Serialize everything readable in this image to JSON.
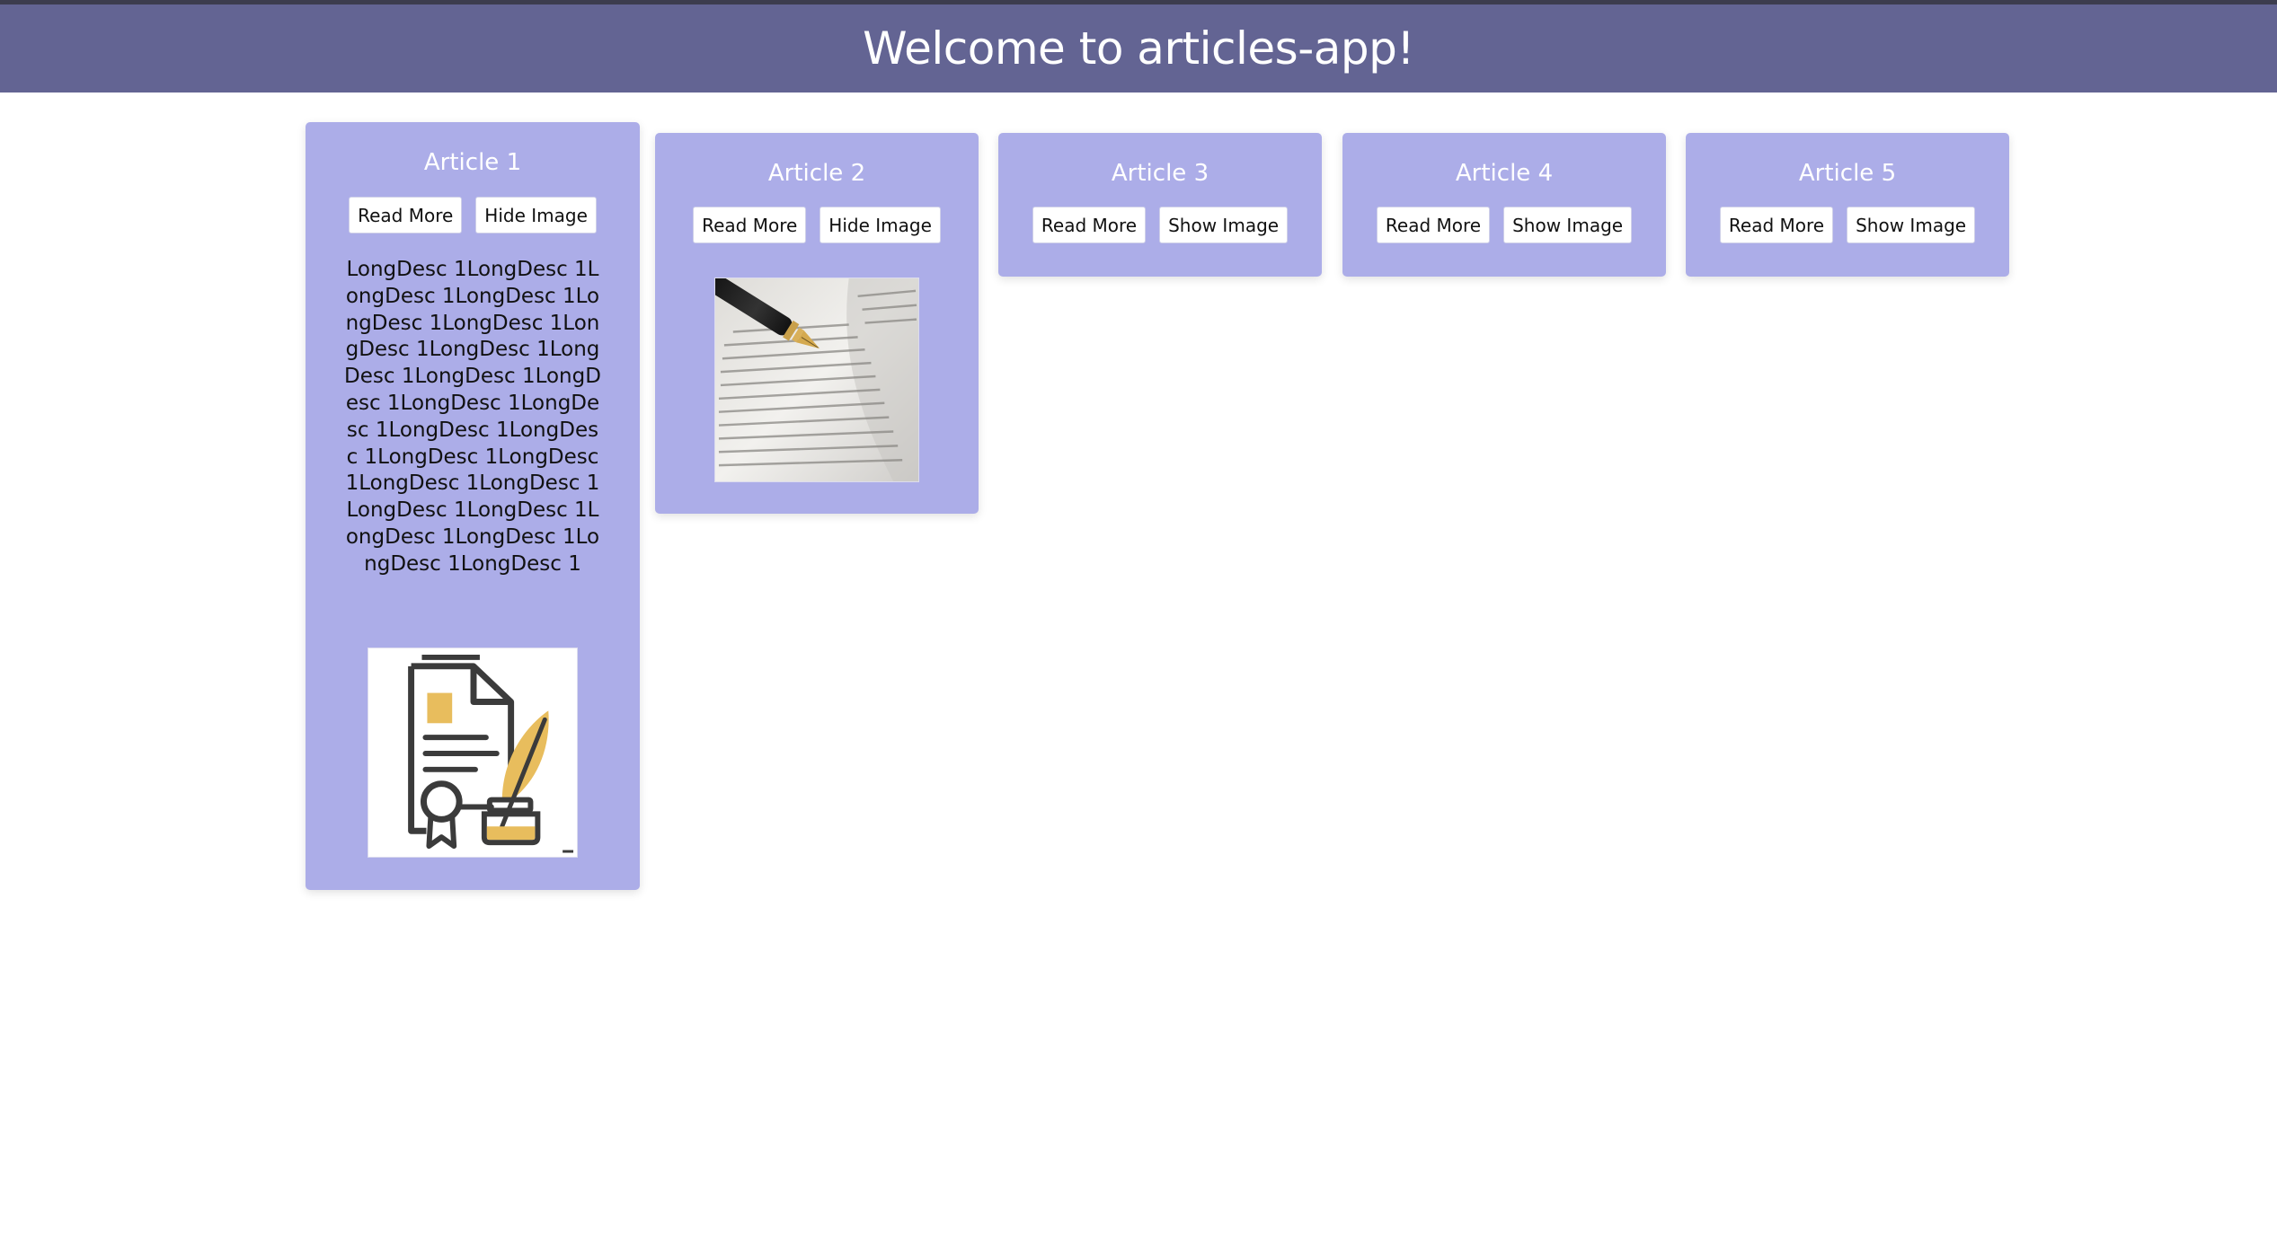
{
  "header": {
    "title": "Welcome to articles-app!"
  },
  "articles": [
    {
      "title": "Article 1",
      "read_more_label": "Read More",
      "image_toggle_label": "Hide Image",
      "description": "LongDesc 1LongDesc 1LongDesc 1LongDesc 1LongDesc 1LongDesc 1LongDesc 1LongDesc 1LongDesc 1LongDesc 1LongDesc 1LongDesc 1LongDesc 1LongDesc 1LongDesc 1LongDesc 1LongDesc 1LongDesc 1LongDesc 1LongDesc 1LongDesc 1LongDesc 1LongDesc 1LongDesc 1LongDesc 1",
      "image": "certificate-quill-icon"
    },
    {
      "title": "Article 2",
      "read_more_label": "Read More",
      "image_toggle_label": "Hide Image",
      "image": "fountain-pen-on-book-photo"
    },
    {
      "title": "Article 3",
      "read_more_label": "Read More",
      "image_toggle_label": "Show Image"
    },
    {
      "title": "Article 4",
      "read_more_label": "Read More",
      "image_toggle_label": "Show Image"
    },
    {
      "title": "Article 5",
      "read_more_label": "Read More",
      "image_toggle_label": "Show Image"
    }
  ],
  "colors": {
    "header_bg": "#636493",
    "card_bg": "#acade8",
    "text_light": "#ffffff"
  }
}
